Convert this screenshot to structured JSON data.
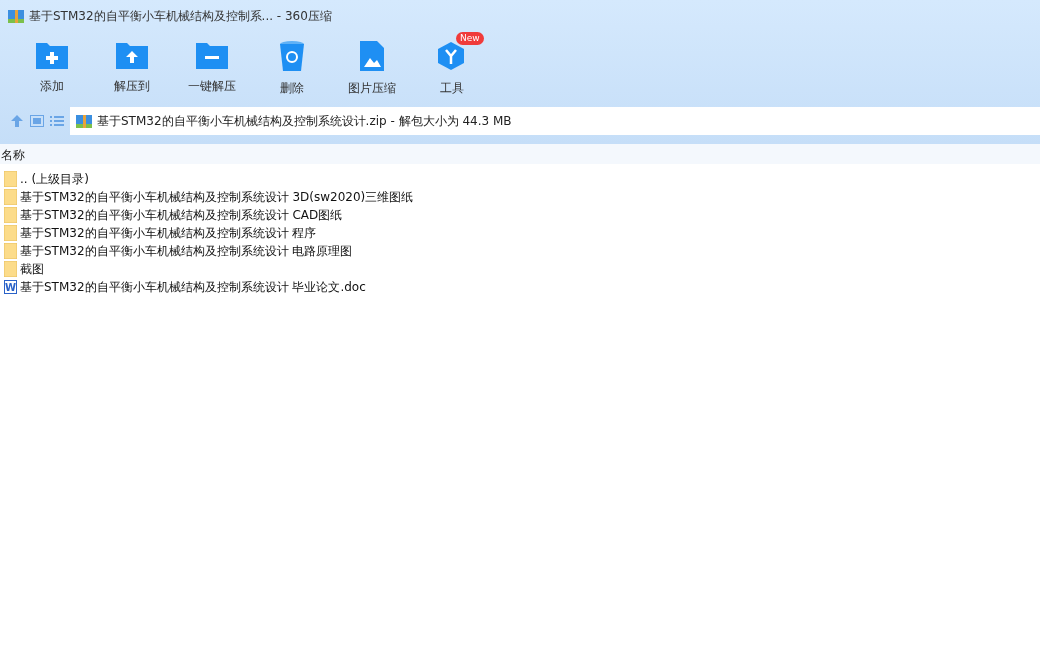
{
  "window": {
    "title": "基于STM32的自平衡小车机械结构及控制系... - 360压缩"
  },
  "toolbar": [
    {
      "kind": "add",
      "label": "添加"
    },
    {
      "kind": "extract",
      "label": "解压到"
    },
    {
      "kind": "quick",
      "label": "一键解压"
    },
    {
      "kind": "delete",
      "label": "删除"
    },
    {
      "kind": "image",
      "label": "图片压缩"
    },
    {
      "kind": "tools",
      "label": "工具",
      "badge": "New"
    }
  ],
  "address": {
    "path": "基于STM32的自平衡小车机械结构及控制系统设计.zip - 解包大小为 44.3 MB"
  },
  "table": {
    "columns": [
      "名称"
    ],
    "rows": [
      {
        "kind": "folder",
        "name": ".. (上级目录)"
      },
      {
        "kind": "folder",
        "name": "基于STM32的自平衡小车机械结构及控制系统设计 3D(sw2020)三维图纸"
      },
      {
        "kind": "folder",
        "name": "基于STM32的自平衡小车机械结构及控制系统设计 CAD图纸"
      },
      {
        "kind": "folder",
        "name": "基于STM32的自平衡小车机械结构及控制系统设计 程序"
      },
      {
        "kind": "folder",
        "name": "基于STM32的自平衡小车机械结构及控制系统设计 电路原理图"
      },
      {
        "kind": "folder",
        "name": "截图"
      },
      {
        "kind": "doc",
        "name": "基于STM32的自平衡小车机械结构及控制系统设计 毕业论文.doc",
        "letter": "W"
      }
    ]
  }
}
